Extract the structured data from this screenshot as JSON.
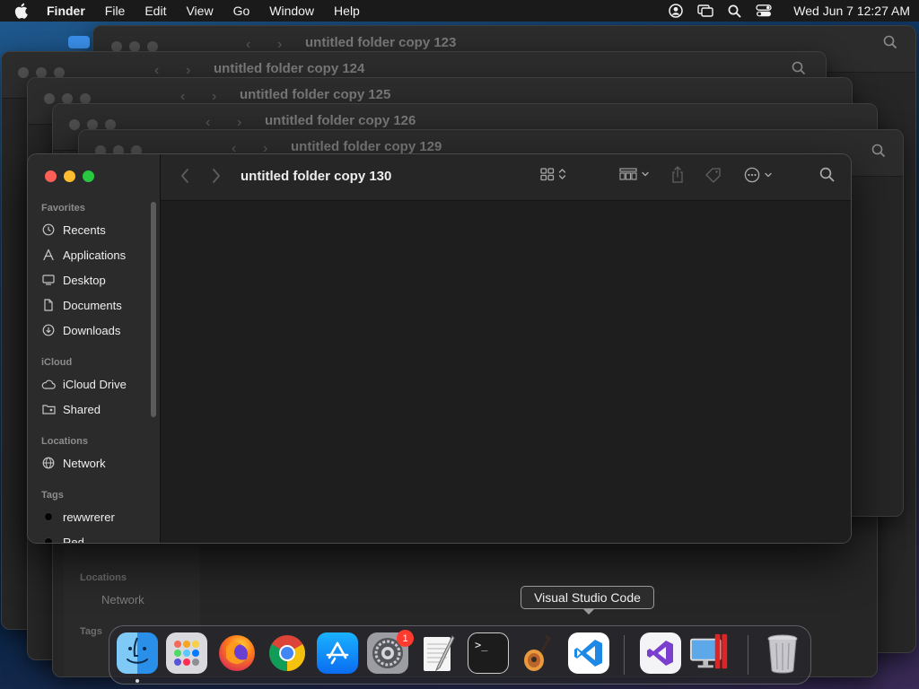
{
  "menubar": {
    "app_name": "Finder",
    "menus": [
      "File",
      "Edit",
      "View",
      "Go",
      "Window",
      "Help"
    ],
    "clock": "Wed Jun 7  12:27 AM",
    "status_icons": [
      "user-icon",
      "screen-mirroring-icon",
      "search-icon",
      "control-center-icon"
    ]
  },
  "background_windows": [
    {
      "title": "untitled folder copy 123"
    },
    {
      "title": "untitled folder copy 124"
    },
    {
      "title": "untitled folder copy 125"
    },
    {
      "title": "untitled folder copy 126"
    },
    {
      "title": "untitled folder copy 129"
    }
  ],
  "background_sidebar_fragments": {
    "locations_label": "Locations",
    "network_label": "Network",
    "tags_label": "Tags"
  },
  "finder": {
    "title": "untitled folder copy 130",
    "sidebar": {
      "favorites_label": "Favorites",
      "favorites": [
        {
          "label": "Recents",
          "icon": "clock-icon"
        },
        {
          "label": "Applications",
          "icon": "applications-icon"
        },
        {
          "label": "Desktop",
          "icon": "desktop-icon"
        },
        {
          "label": "Documents",
          "icon": "document-icon"
        },
        {
          "label": "Downloads",
          "icon": "download-icon"
        }
      ],
      "icloud_label": "iCloud",
      "icloud": [
        {
          "label": "iCloud Drive",
          "icon": "cloud-icon"
        },
        {
          "label": "Shared",
          "icon": "shared-folder-icon"
        }
      ],
      "locations_label": "Locations",
      "locations": [
        {
          "label": "Network",
          "icon": "globe-icon"
        }
      ],
      "tags_label": "Tags",
      "tags": [
        {
          "label": "rewwrerer",
          "color": "#050505"
        },
        {
          "label": "Red",
          "color": "#050505"
        }
      ]
    },
    "toolbar_icons": [
      "back-icon",
      "forward-icon",
      "view-grid-icon",
      "group-icon",
      "share-icon",
      "tag-icon",
      "more-icon",
      "search-icon"
    ]
  },
  "dock": {
    "tooltip": "Visual Studio Code",
    "apps": [
      {
        "name": "Finder",
        "icon": "finder-icon",
        "running": true
      },
      {
        "name": "Launchpad",
        "icon": "launchpad-icon"
      },
      {
        "name": "Firefox",
        "icon": "firefox-icon"
      },
      {
        "name": "Google Chrome",
        "icon": "chrome-icon"
      },
      {
        "name": "App Store",
        "icon": "app-store-icon"
      },
      {
        "name": "System Settings",
        "icon": "settings-icon",
        "badge": "1"
      },
      {
        "name": "TextEdit",
        "icon": "textedit-icon"
      },
      {
        "name": "Terminal",
        "icon": "terminal-icon",
        "glyph": ">_"
      },
      {
        "name": "GarageBand",
        "icon": "garageband-icon"
      },
      {
        "name": "Visual Studio Code",
        "icon": "vscode-icon"
      },
      {
        "name": "Visual Studio",
        "icon": "visual-studio-icon"
      },
      {
        "name": "Parallels Desktop",
        "icon": "parallels-icon"
      },
      {
        "name": "Trash",
        "icon": "trash-icon"
      }
    ]
  },
  "colors": {
    "close": "#ff5f57",
    "minimize": "#febc2e",
    "zoom": "#28c840",
    "badge": "#ff3b30"
  }
}
